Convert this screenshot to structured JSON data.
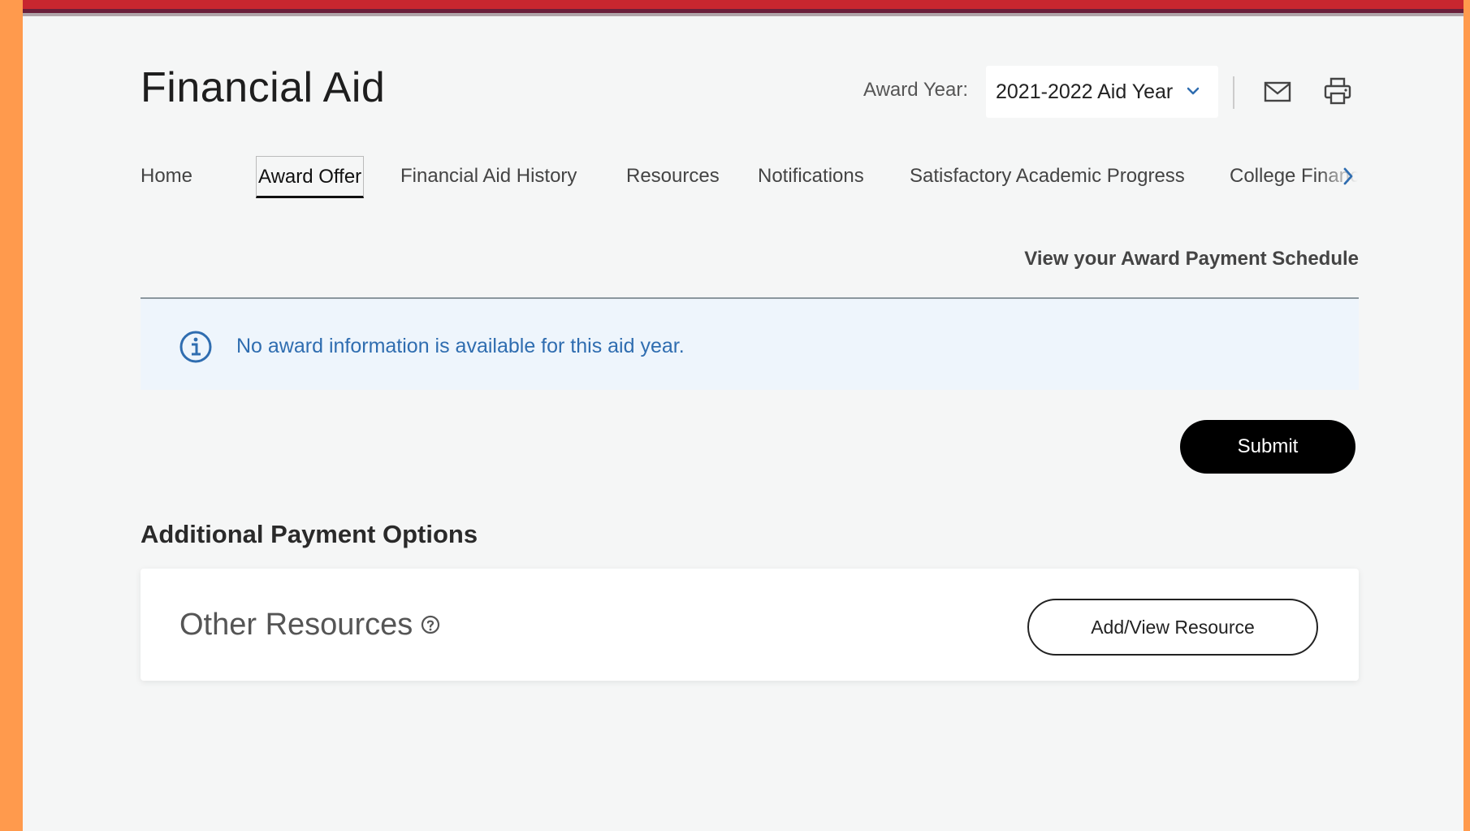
{
  "page": {
    "title": "Financial Aid"
  },
  "header": {
    "award_year_label": "Award Year:",
    "award_year_value": "2021-2022 Aid Year",
    "mail_icon": "mail-icon",
    "print_icon": "print-icon"
  },
  "tabs": [
    {
      "label": "Home",
      "active": false
    },
    {
      "label": "Award Offer",
      "active": true
    },
    {
      "label": "Financial Aid History",
      "active": false
    },
    {
      "label": "Resources",
      "active": false
    },
    {
      "label": "Notifications",
      "active": false
    },
    {
      "label": "Satisfactory Academic Progress",
      "active": false
    },
    {
      "label": "College Financ",
      "active": false
    }
  ],
  "links": {
    "payment_schedule": "View your Award Payment Schedule"
  },
  "info": {
    "message": "No award information is available for this aid year.",
    "icon": "info-icon"
  },
  "actions": {
    "submit_label": "Submit"
  },
  "additional": {
    "title": "Additional Payment Options",
    "card_title": "Other Resources",
    "help_icon": "help-icon",
    "add_view_label": "Add/View Resource"
  },
  "colors": {
    "accent_blue": "#2f6db0",
    "info_bg": "#eef5fc",
    "brand_red": "#c8262f",
    "border_orange": "#ff9a4d"
  }
}
